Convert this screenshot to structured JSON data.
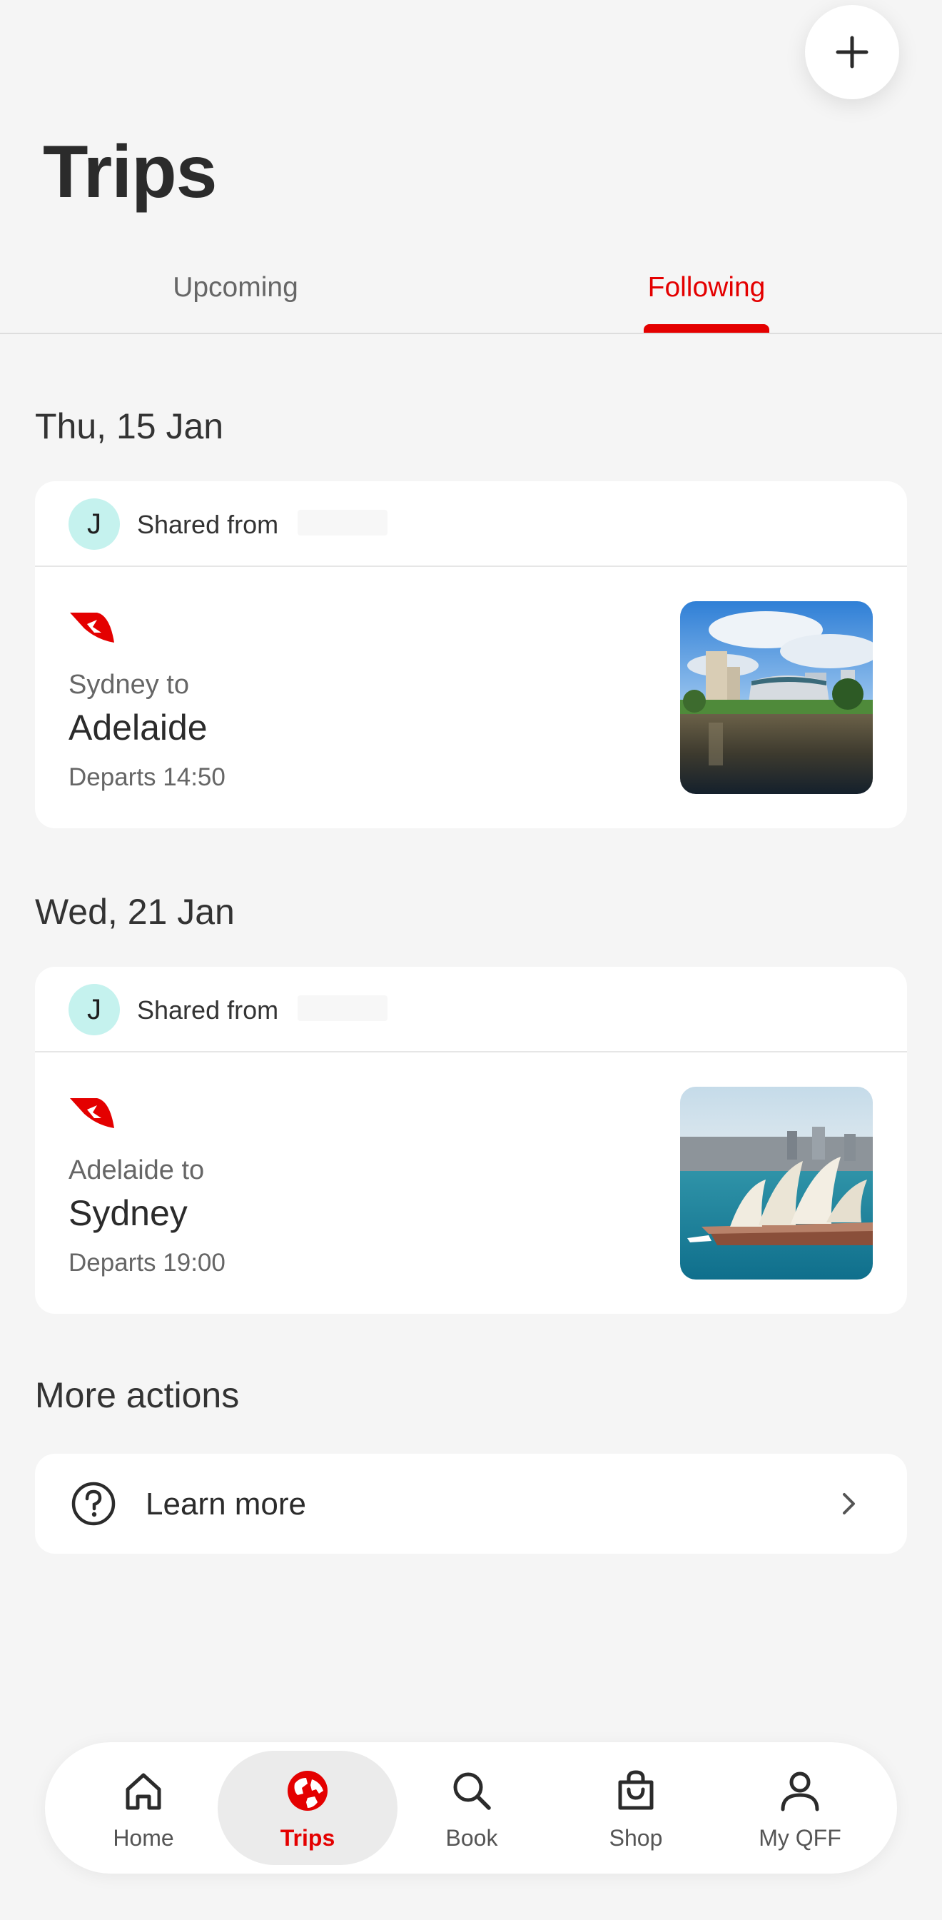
{
  "header": {
    "title": "Trips",
    "add_icon": "plus-icon"
  },
  "tabs": [
    {
      "label": "Upcoming",
      "active": false
    },
    {
      "label": "Following",
      "active": true
    }
  ],
  "trips": [
    {
      "date": "Thu, 15 Jan",
      "shared_initial": "J",
      "shared_label": "Shared from",
      "from": "Sydney to",
      "destination": "Adelaide",
      "departs": "Departs 14:50",
      "image": "adelaide-city-photo"
    },
    {
      "date": "Wed, 21 Jan",
      "shared_initial": "J",
      "shared_label": "Shared from",
      "from": "Adelaide to",
      "destination": "Sydney",
      "departs": "Departs 19:00",
      "image": "sydney-opera-house-photo"
    }
  ],
  "more_actions": {
    "heading": "More actions",
    "learn_more": "Learn more"
  },
  "nav": [
    {
      "label": "Home",
      "icon": "home-icon",
      "active": false
    },
    {
      "label": "Trips",
      "icon": "globe-icon",
      "active": true
    },
    {
      "label": "Book",
      "icon": "search-icon",
      "active": false
    },
    {
      "label": "Shop",
      "icon": "shopping-bag-icon",
      "active": false
    },
    {
      "label": "My QFF",
      "icon": "person-icon",
      "active": false
    }
  ],
  "colors": {
    "accent": "#e40000",
    "background": "#f5f5f5",
    "card": "#ffffff",
    "avatar": "#c5f2ee"
  }
}
